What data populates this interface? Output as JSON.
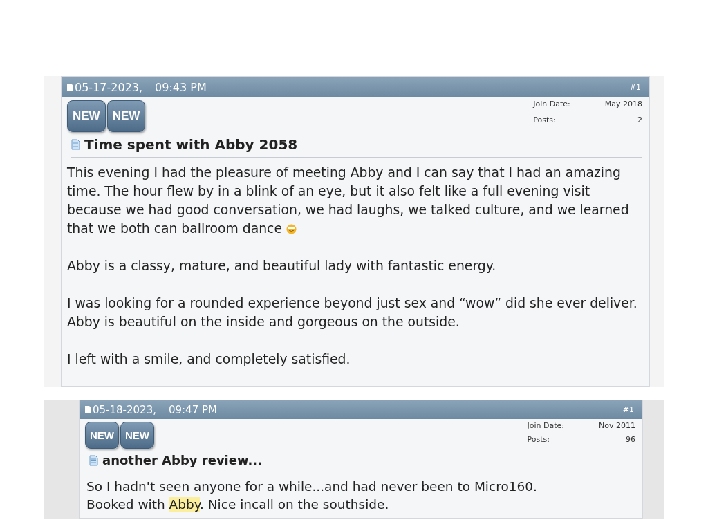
{
  "posts": [
    {
      "date": "05-17-2023,",
      "time": "09:43 PM",
      "number": "#1",
      "badges": [
        "NEW",
        "NEW"
      ],
      "join_date_label": "Join Date:",
      "join_date": "May 2018",
      "posts_label": "Posts:",
      "posts": "2",
      "title": "Time spent with Abby 2058",
      "paragraphs": [
        {
          "parts": [
            {
              "text": "This evening I had the pleasure of meeting Abby and I can say that I had an amazing time. The hour flew by in a blink of an eye, but it also felt like a full evening visit because we had good conversation, we had laughs, we talked culture, and we learned that we both can ballroom dance",
              "highlighted": false
            }
          ],
          "emoticon": true
        },
        {
          "parts": [
            {
              "text": "Abby is a classy, mature, and beautiful lady with fantastic energy.",
              "highlighted": false
            }
          ],
          "emoticon": false
        },
        {
          "parts": [
            {
              "text": "I was looking for a rounded experience beyond just sex and “wow” did she ever deliver. Abby is beautiful on the inside and gorgeous on the outside.",
              "highlighted": false
            }
          ],
          "emoticon": false
        },
        {
          "parts": [
            {
              "text": "I left with a smile, and completely satisfied.",
              "highlighted": false
            }
          ],
          "emoticon": false
        }
      ]
    },
    {
      "date": "05-18-2023,",
      "time": "09:47 PM",
      "number": "#1",
      "badges": [
        "NEW",
        "NEW"
      ],
      "join_date_label": "Join Date:",
      "join_date": "Nov 2011",
      "posts_label": "Posts:",
      "posts": "96",
      "title": "another Abby review...",
      "paragraphs": [
        {
          "parts": [
            {
              "text": "So I hadn't seen anyone for a while...and had never been to Micro160.",
              "highlighted": false
            }
          ],
          "emoticon": false
        },
        {
          "parts": [
            {
              "text": "Booked with ",
              "highlighted": false
            },
            {
              "text": "Abby",
              "highlighted": true
            },
            {
              "text": ". Nice incall on the southside.",
              "highlighted": false
            }
          ],
          "emoticon": false
        }
      ]
    }
  ]
}
